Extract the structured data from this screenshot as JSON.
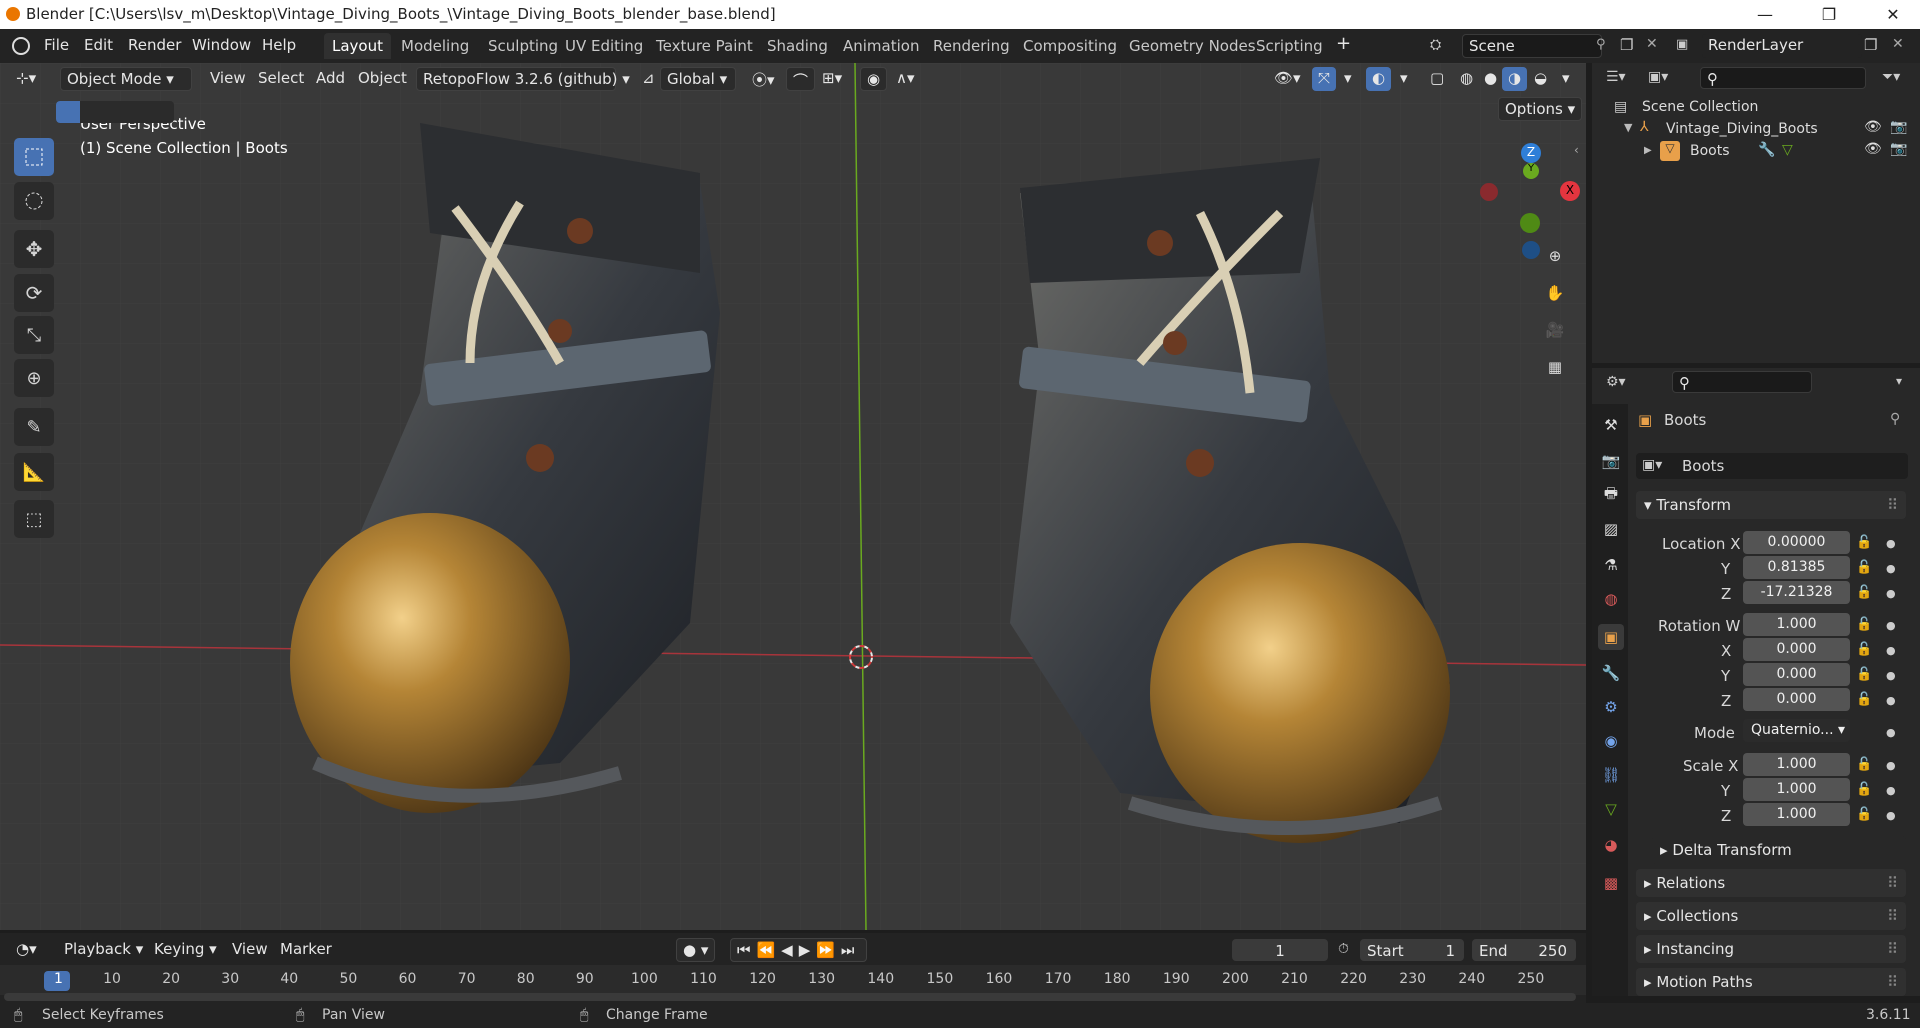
{
  "window": {
    "title": "Blender [C:\\Users\\lsv_m\\Desktop\\Vintage_Diving_Boots_\\Vintage_Diving_Boots_blender_base.blend]",
    "minimize": "—",
    "restore": "❐",
    "close": "✕"
  },
  "menu": {
    "file": "File",
    "edit": "Edit",
    "render": "Render",
    "window": "Window",
    "help": "Help"
  },
  "workspaces": [
    "Layout",
    "Modeling",
    "Sculpting",
    "UV Editing",
    "Texture Paint",
    "Shading",
    "Animation",
    "Rendering",
    "Compositing",
    "Geometry Nodes",
    "Scripting"
  ],
  "active_workspace": "Layout",
  "scene": {
    "name": "Scene",
    "render_layer": "RenderLayer"
  },
  "viewport": {
    "mode": "Object Mode",
    "view": "View",
    "select": "Select",
    "add": "Add",
    "object": "Object",
    "addon": "RetopoFlow 3.2.6 (github)",
    "transform_orientation": "Global",
    "options": "Options",
    "perspective": "User Perspective",
    "collection_info": "(1) Scene Collection | Boots",
    "gizmo": {
      "x": "X",
      "y": "Y",
      "z": "Z"
    }
  },
  "outliner": {
    "root": "Scene Collection",
    "collection": "Vintage_Diving_Boots",
    "object": "Boots"
  },
  "properties": {
    "object_name": "Boots",
    "data_name": "Boots",
    "transform_label": "Transform",
    "location": {
      "label": "Location X",
      "x": "0.00000",
      "y_label": "Y",
      "y": "0.81385",
      "z_label": "Z",
      "z": "-17.21328"
    },
    "rotation": {
      "label": "Rotation W",
      "w": "1.000",
      "x_label": "X",
      "x": "0.000",
      "y_label": "Y",
      "y": "0.000",
      "z_label": "Z",
      "z": "0.000"
    },
    "mode": {
      "label": "Mode",
      "value": "Quaternio..."
    },
    "scale": {
      "label": "Scale X",
      "x": "1.000",
      "y_label": "Y",
      "y": "1.000",
      "z_label": "Z",
      "z": "1.000"
    },
    "panels": [
      "Delta Transform",
      "Relations",
      "Collections",
      "Instancing",
      "Motion Paths"
    ]
  },
  "timeline": {
    "playback": "Playback",
    "keying": "Keying",
    "view": "View",
    "marker": "Marker",
    "current_frame": "1",
    "start_label": "Start",
    "start": "1",
    "end_label": "End",
    "end": "250",
    "frames": [
      "1",
      "10",
      "20",
      "30",
      "40",
      "50",
      "60",
      "70",
      "80",
      "90",
      "100",
      "110",
      "120",
      "130",
      "140",
      "150",
      "160",
      "170",
      "180",
      "190",
      "200",
      "210",
      "220",
      "230",
      "240",
      "250"
    ]
  },
  "status": {
    "left": "Select Keyframes",
    "middle": "Pan View",
    "right": "Change Frame",
    "version": "3.6.11"
  },
  "colors": {
    "accent": "#4772b3",
    "axis_x": "#e4353f",
    "axis_y": "#6aaa1f",
    "axis_z": "#2f7fd8"
  }
}
